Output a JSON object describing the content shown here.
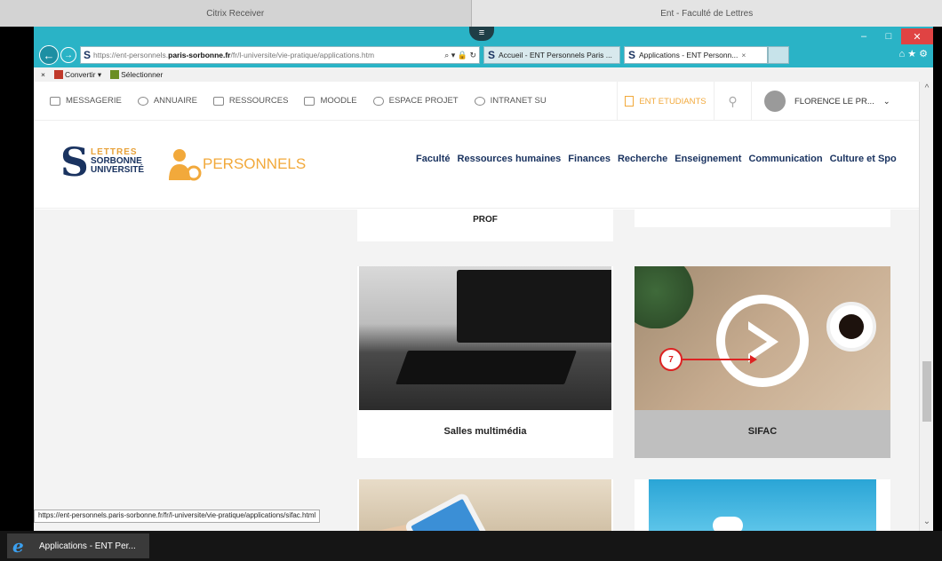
{
  "citrix": {
    "left_tab": "Citrix Receiver",
    "right_tab": "Ent - Faculté de Lettres"
  },
  "window": {
    "pull_tab_symbol": "≡",
    "minimize": "–",
    "maximize": "□",
    "close": "✕"
  },
  "browser": {
    "back_symbol": "←",
    "forward_symbol": "→",
    "address": {
      "prefix": "https://",
      "host_pre": "ent-personnels.",
      "host_bold": "paris-sorbonne.fr",
      "path": "/fr/l-universite/vie-pratique/applications.htm",
      "tools": "⌕ ▾ 🔒 ↻"
    },
    "tabs": [
      {
        "label": "Accueil - ENT Personnels Paris ..."
      },
      {
        "label": "Applications - ENT Personn...",
        "close": "×"
      }
    ],
    "toolbar_icons": "⌂ ★ ⚙",
    "command_bar": {
      "close_symbol": "×",
      "convert_label": "Convertir",
      "convert_arrow": "▾",
      "select_label": "Sélectionner"
    },
    "status_url": "https://ent-personnels.paris-sorbonne.fr/fr/l-universite/vie-pratique/applications/sifac.html"
  },
  "site": {
    "top_nav": [
      {
        "label": "MESSAGERIE",
        "icon": "mail-icon"
      },
      {
        "label": "ANNUAIRE",
        "icon": "person-icon"
      },
      {
        "label": "RESSOURCES",
        "icon": "folder-icon"
      },
      {
        "label": "MOODLE",
        "icon": "folder-icon"
      },
      {
        "label": "ESPACE PROJET",
        "icon": "star-icon"
      },
      {
        "label": "INTRANET SU",
        "icon": "help-icon"
      }
    ],
    "ent_etudiants": "ENT ETUDIANTS",
    "search_symbol": "⚲",
    "user_name": "FLORENCE LE PR...",
    "user_chevron": "⌄",
    "logo_s": "S",
    "logo_lines": [
      "LETTRES",
      "SORBONNE",
      "UNIVERSITÉ"
    ],
    "personnels_label": "PERSONNELS",
    "main_menu": [
      "Faculté",
      "Ressources humaines",
      "Finances",
      "Recherche",
      "Enseignement",
      "Communication",
      "Culture et Spo"
    ],
    "cards": {
      "prof_label": "PROF",
      "multimedia_label": "Salles multimédia",
      "sifac_label": "SIFAC",
      "marker_number": "7"
    },
    "accent_color": "#f2a93b",
    "brand_color": "#1a3360"
  },
  "scrollbar": {
    "up": "^",
    "down": "⌄"
  },
  "taskbar": {
    "ie_logo": "e",
    "item_label": "Applications - ENT Per..."
  }
}
